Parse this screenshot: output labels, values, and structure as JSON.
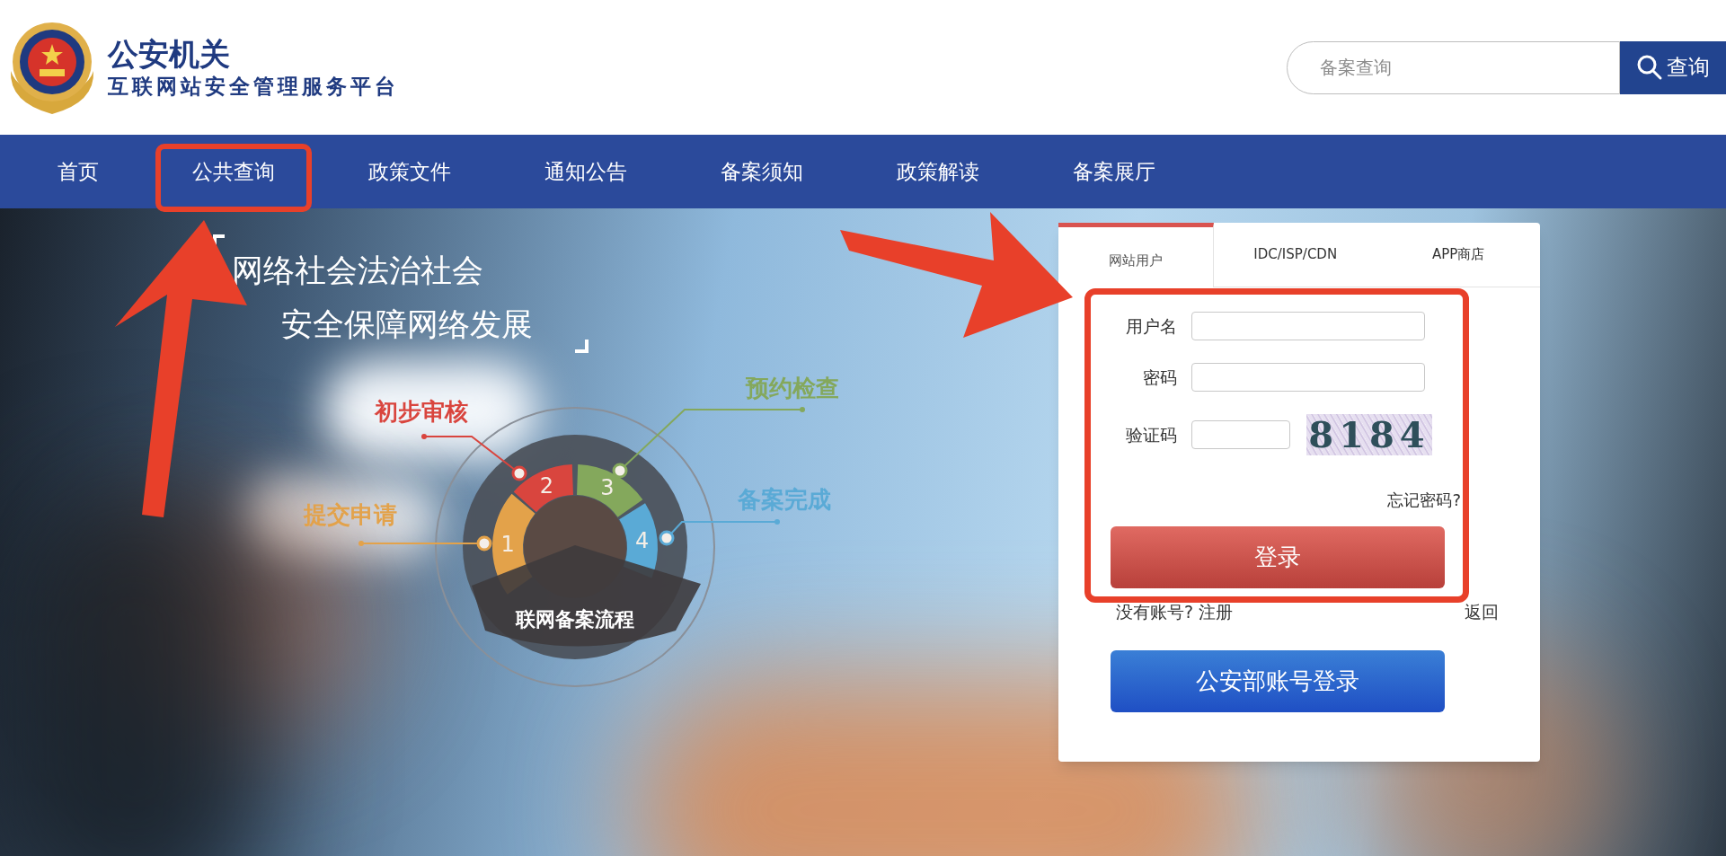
{
  "header": {
    "title": "公安机关",
    "subtitle": "互联网站安全管理服务平台",
    "search": {
      "placeholder": "备案查询",
      "button": "查询"
    }
  },
  "nav": [
    "首页",
    "公共查询",
    "政策文件",
    "通知公告",
    "备案须知",
    "政策解读",
    "备案展厅"
  ],
  "hero": {
    "slogan": [
      "网络社会法治社会",
      "安全保障网络发展"
    ],
    "process": {
      "title": "联网备案流程",
      "steps": [
        {
          "number": "2",
          "label": "初步审核",
          "color": "#d9453e"
        },
        {
          "number": "1",
          "label": "提交申请",
          "color": "#e3a24a"
        },
        {
          "number": "3",
          "label": "预约检查",
          "color": "#84a85c"
        },
        {
          "number": "4",
          "label": "备案完成",
          "color": "#5aaad6"
        }
      ]
    }
  },
  "login": {
    "tabs": [
      {
        "label": "网站用户",
        "selected": true
      },
      {
        "label": "IDC/ISP/CDN",
        "selected": false
      },
      {
        "label": "APP商店",
        "selected": false
      }
    ],
    "fields": [
      {
        "kind": "text",
        "label": "用户名"
      },
      {
        "kind": "password",
        "label": "密码"
      },
      {
        "kind": "captcha",
        "label": "验证码",
        "captcha": "8184"
      }
    ],
    "forgot": "忘记密码?",
    "submit": "登录",
    "register_prompt": "没有账号?",
    "register": "注册",
    "back": "返回",
    "alt_login": "公安部账号登录"
  }
}
